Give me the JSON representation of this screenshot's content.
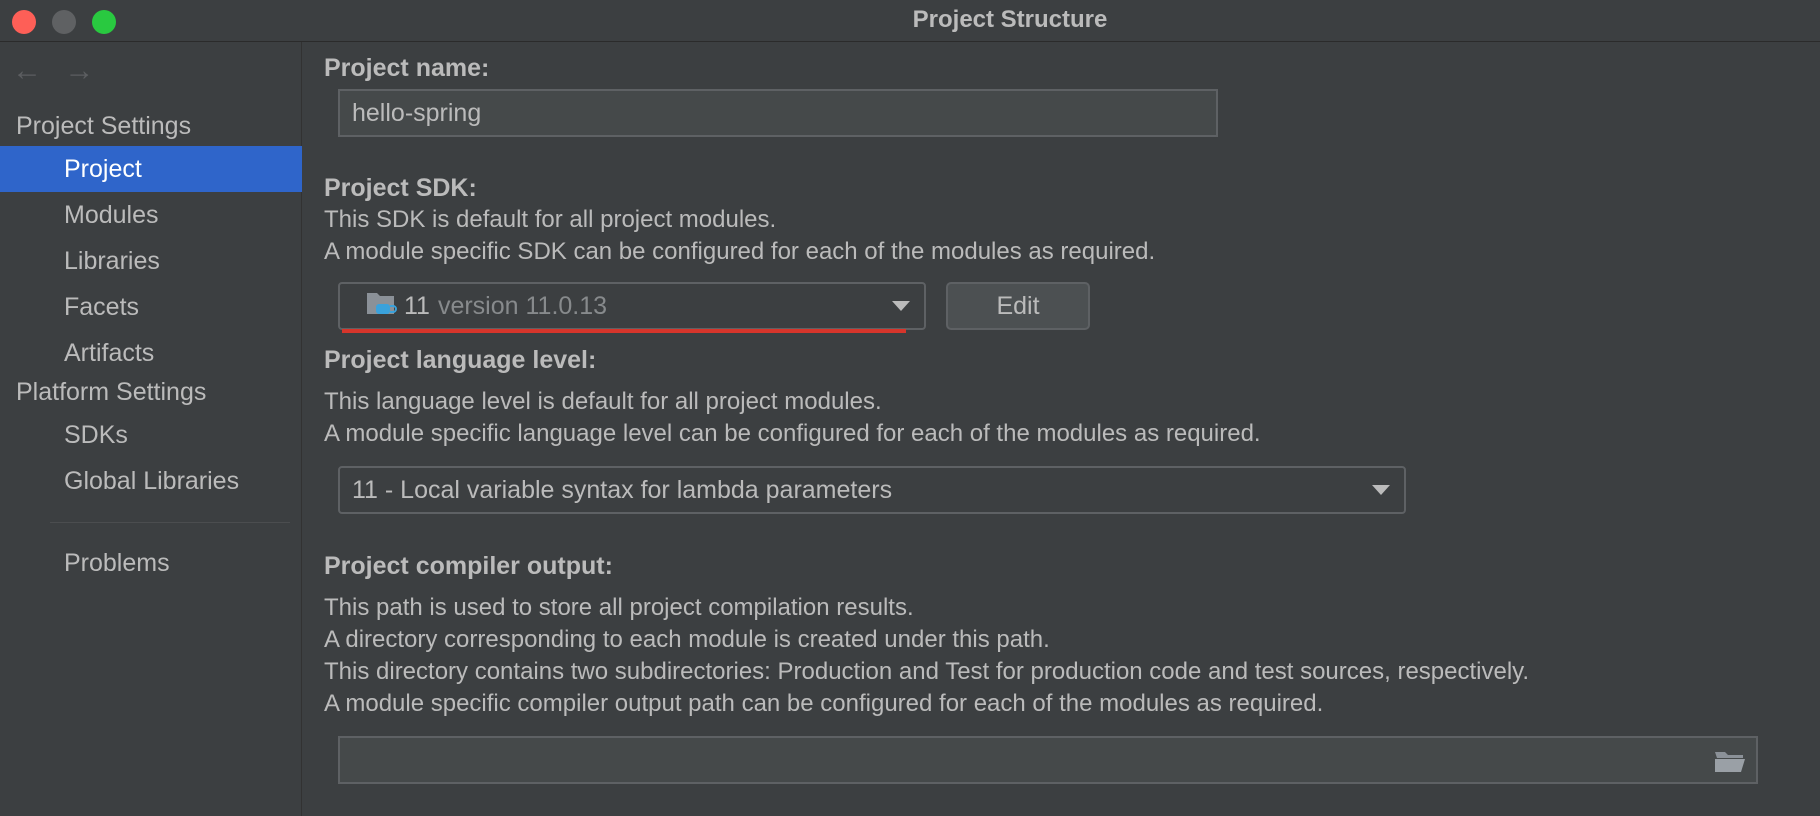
{
  "window": {
    "title": "Project Structure"
  },
  "nav": {
    "back": "←",
    "forward": "→"
  },
  "sidebar": {
    "project_settings_header": "Project Settings",
    "project_items": [
      "Project",
      "Modules",
      "Libraries",
      "Facets",
      "Artifacts"
    ],
    "platform_settings_header": "Platform Settings",
    "platform_items": [
      "SDKs",
      "Global Libraries"
    ],
    "problems": "Problems",
    "active_item": "Project"
  },
  "project_name": {
    "label": "Project name:",
    "value": "hello-spring"
  },
  "project_sdk": {
    "label": "Project SDK:",
    "desc1": "This SDK is default for all project modules.",
    "desc2": "A module specific SDK can be configured for each of the modules as required.",
    "selected_name": "11",
    "selected_version": "version 11.0.13",
    "edit_button": "Edit"
  },
  "language_level": {
    "label": "Project language level:",
    "desc1": "This language level is default for all project modules.",
    "desc2": "A module specific language level can be configured for each of the modules as required.",
    "selected": "11 - Local variable syntax for lambda parameters"
  },
  "compiler_output": {
    "label": "Project compiler output:",
    "desc1": "This path is used to store all project compilation results.",
    "desc2": "A directory corresponding to each module is created under this path.",
    "desc3": "This directory contains two subdirectories: Production and Test for production code and test sources, respectively.",
    "desc4": "A module specific compiler output path can be configured for each of the modules as required.",
    "value": ""
  },
  "colors": {
    "accent": "#2f65ca",
    "error_underline": "#d6352b",
    "background": "#3c3f41"
  }
}
